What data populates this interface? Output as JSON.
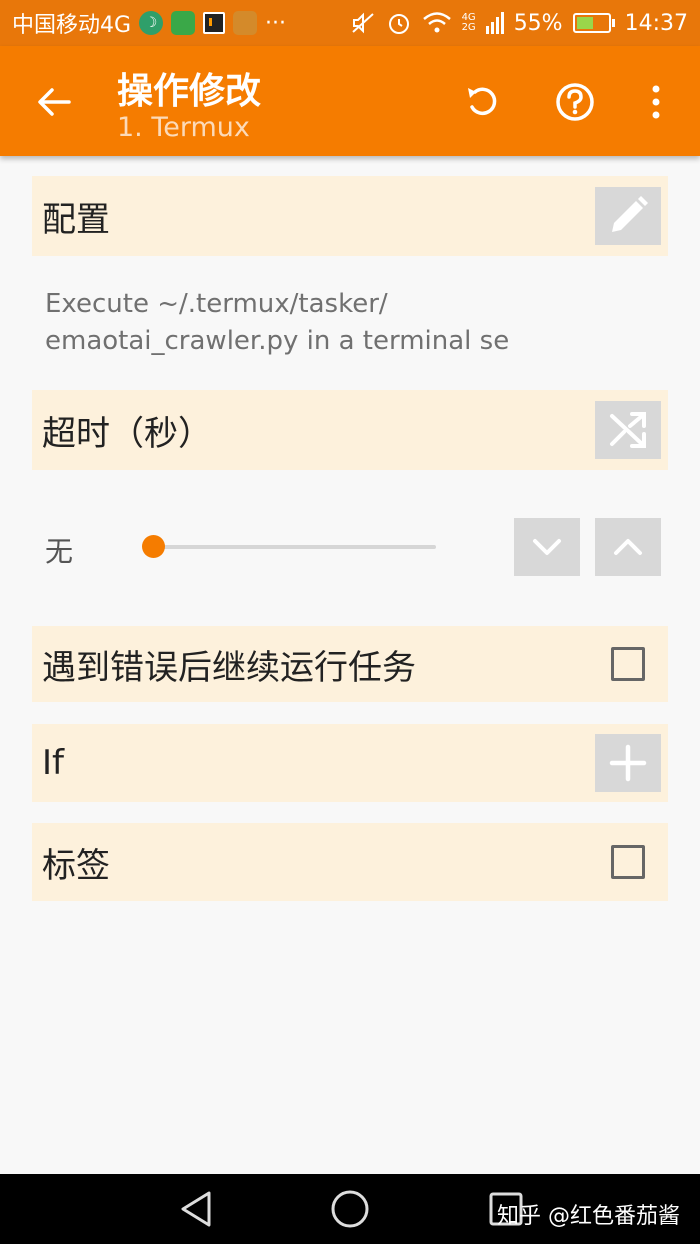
{
  "statusbar": {
    "carrier": "中国移动4G",
    "more": "···",
    "network_top": "4G",
    "network_bottom": "2G",
    "battery": "55%",
    "battery_level": 0.55,
    "time": "14:37"
  },
  "appbar": {
    "title": "操作修改",
    "subtitle": "1. Termux",
    "back_icon": "arrow-back-icon",
    "actions": [
      "undo-icon",
      "help-icon",
      "more-vert-icon"
    ]
  },
  "config": {
    "label": "配置",
    "description": "Execute ~/.termux/tasker/\nemaotai_crawler.py in a terminal se"
  },
  "timeout": {
    "label": "超时（秒）",
    "value_label": "无",
    "slider_value": 0
  },
  "continue_on_error": {
    "label": "遇到错误后继续运行任务",
    "checked": false
  },
  "if_section": {
    "label": "If"
  },
  "tag": {
    "label": "标签",
    "checked": false
  },
  "watermark": "知乎 @红色番茄酱",
  "colors": {
    "accent": "#f57c00",
    "section_bg": "#fdf1dc",
    "button_bg": "#d8d8d8"
  }
}
